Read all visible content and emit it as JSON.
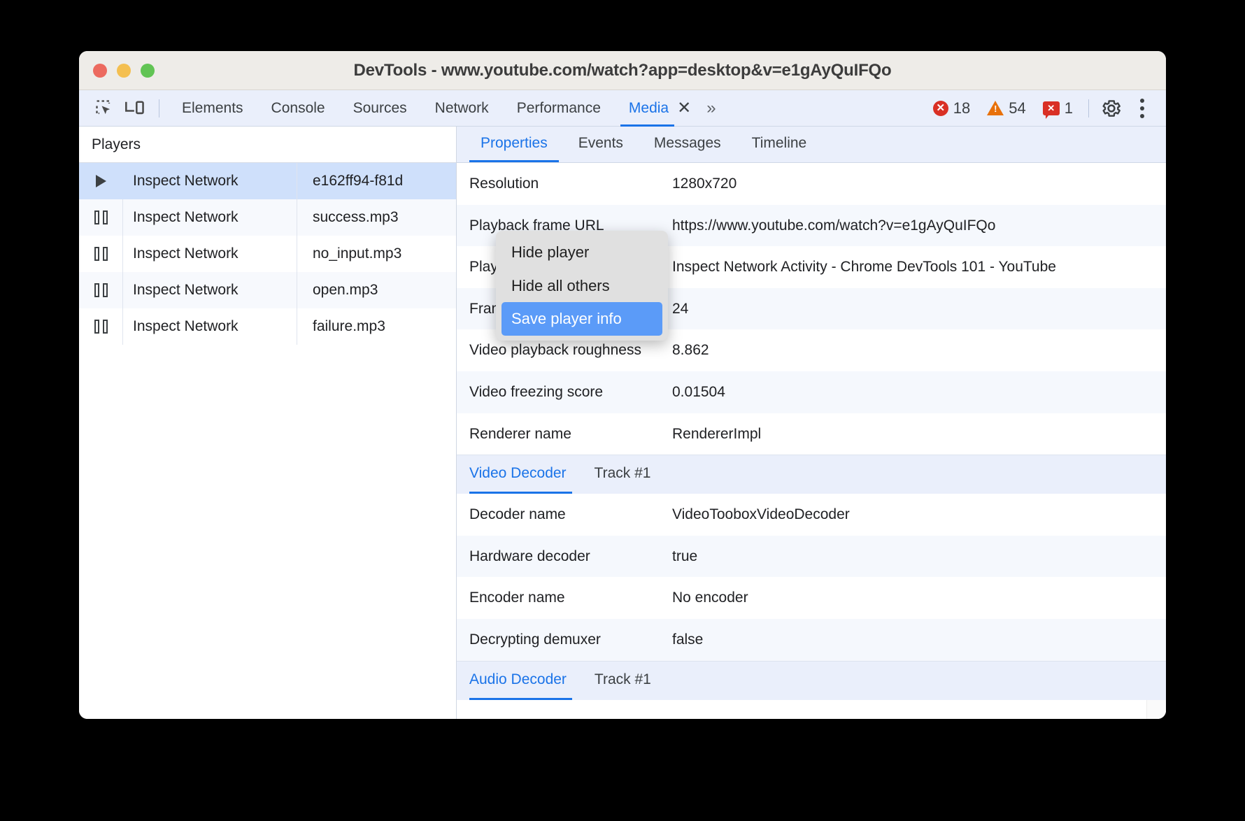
{
  "window": {
    "title": "DevTools - www.youtube.com/watch?app=desktop&v=e1gAyQuIFQo",
    "traffic_lights": [
      "close-red",
      "minimize-yellow",
      "maximize-green"
    ]
  },
  "toolbar": {
    "inspect_icon": "inspect-element-icon",
    "device_icon": "device-toolbar-icon",
    "tabs": [
      {
        "label": "Elements",
        "active": false
      },
      {
        "label": "Console",
        "active": false
      },
      {
        "label": "Sources",
        "active": false
      },
      {
        "label": "Network",
        "active": false
      },
      {
        "label": "Performance",
        "active": false
      },
      {
        "label": "Media",
        "active": true
      }
    ],
    "close_tab_label": "✕",
    "more_tabs_label": "»",
    "counters": {
      "errors": "18",
      "warnings": "54",
      "issues": "1",
      "error_glyph": "✕",
      "warning_glyph": "!",
      "issue_glyph": "✕"
    },
    "settings_icon": "gear-icon",
    "menu_icon": "kebab-menu-icon",
    "colors": {
      "error": "#d93025",
      "warning": "#e8710a",
      "accent": "#1a73e8"
    }
  },
  "players_panel": {
    "header": "Players",
    "rows": [
      {
        "icon": "play-icon",
        "name": "Inspect Network",
        "id": "e162ff94-f81d",
        "selected": true
      },
      {
        "icon": "pause-icon",
        "name": "Inspect Network",
        "id": "success.mp3",
        "selected": false
      },
      {
        "icon": "pause-icon",
        "name": "Inspect Network",
        "id": "no_input.mp3",
        "selected": false
      },
      {
        "icon": "pause-icon",
        "name": "Inspect Network",
        "id": "open.mp3",
        "selected": false
      },
      {
        "icon": "pause-icon",
        "name": "Inspect Network",
        "id": "failure.mp3",
        "selected": false
      }
    ]
  },
  "context_menu": {
    "items": [
      {
        "label": "Hide player",
        "selected": false
      },
      {
        "label": "Hide all others",
        "selected": false
      },
      {
        "label": "Save player info",
        "selected": true
      }
    ]
  },
  "details_panel": {
    "tabs": [
      {
        "label": "Properties",
        "active": true
      },
      {
        "label": "Events",
        "active": false
      },
      {
        "label": "Messages",
        "active": false
      },
      {
        "label": "Timeline",
        "active": false
      }
    ],
    "properties": [
      {
        "key": "Resolution",
        "value": "1280x720"
      },
      {
        "key": "Playback frame URL",
        "value": "https://www.youtube.com/watch?v=e1gAyQuIFQo"
      },
      {
        "key": "Playback frame title",
        "value": "Inspect Network Activity - Chrome DevTools 101 - YouTube"
      },
      {
        "key": "Frame rate",
        "value": "24"
      },
      {
        "key": "Video playback roughness",
        "value": "8.862"
      },
      {
        "key": "Video freezing score",
        "value": "0.01504"
      },
      {
        "key": "Renderer name",
        "value": "RendererImpl"
      }
    ],
    "video_decoder_section": {
      "tabs": [
        {
          "label": "Video Decoder",
          "active": true
        },
        {
          "label": "Track #1",
          "active": false
        }
      ],
      "properties": [
        {
          "key": "Decoder name",
          "value": "VideoTooboxVideoDecoder"
        },
        {
          "key": "Hardware decoder",
          "value": "true"
        },
        {
          "key": "Encoder name",
          "value": "No encoder"
        },
        {
          "key": "Decrypting demuxer",
          "value": "false"
        }
      ]
    },
    "audio_decoder_section": {
      "tabs": [
        {
          "label": "Audio Decoder",
          "active": true
        },
        {
          "label": "Track #1",
          "active": false
        }
      ]
    }
  }
}
